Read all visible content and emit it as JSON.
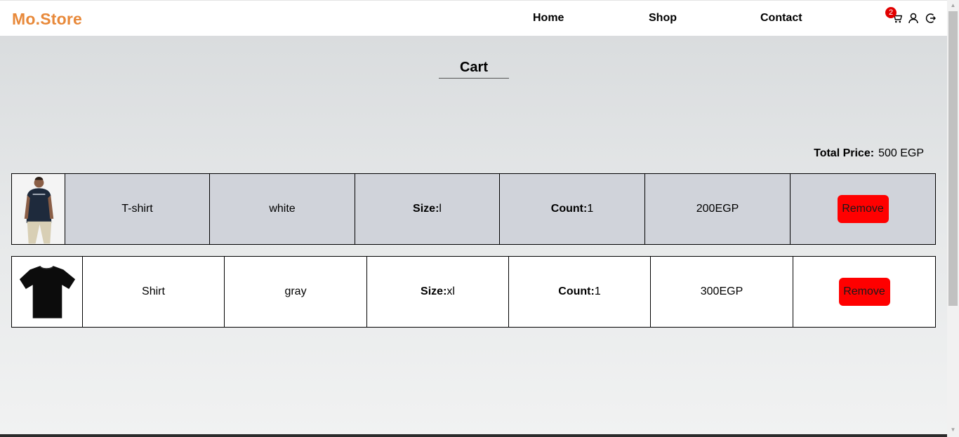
{
  "brand": "Mo.Store",
  "nav": {
    "home": "Home",
    "shop": "Shop",
    "contact": "Contact"
  },
  "header_icons": {
    "cart_count": "2",
    "cart": "cart-icon",
    "user": "user-icon",
    "logout": "logout-icon"
  },
  "page_title": "Cart",
  "total": {
    "label": "Total Price:",
    "value": "500 EGP"
  },
  "items": [
    {
      "image": "model-tshirt-image",
      "name": "T-shirt",
      "color": "white",
      "size_label": "Size:",
      "size": "l",
      "count_label": "Count:",
      "count": "1",
      "price": "200EGP",
      "remove": "Remove"
    },
    {
      "image": "black-shirt-image",
      "name": "Shirt",
      "color": "gray",
      "size_label": "Size:",
      "size": "xl",
      "count_label": "Count:",
      "count": "1",
      "price": "300EGP",
      "remove": "Remove"
    }
  ],
  "colors": {
    "brand": "#e8893a",
    "remove_button": "#ff0000",
    "badge": "#e10000",
    "row_highlight": "#d0d3da"
  }
}
